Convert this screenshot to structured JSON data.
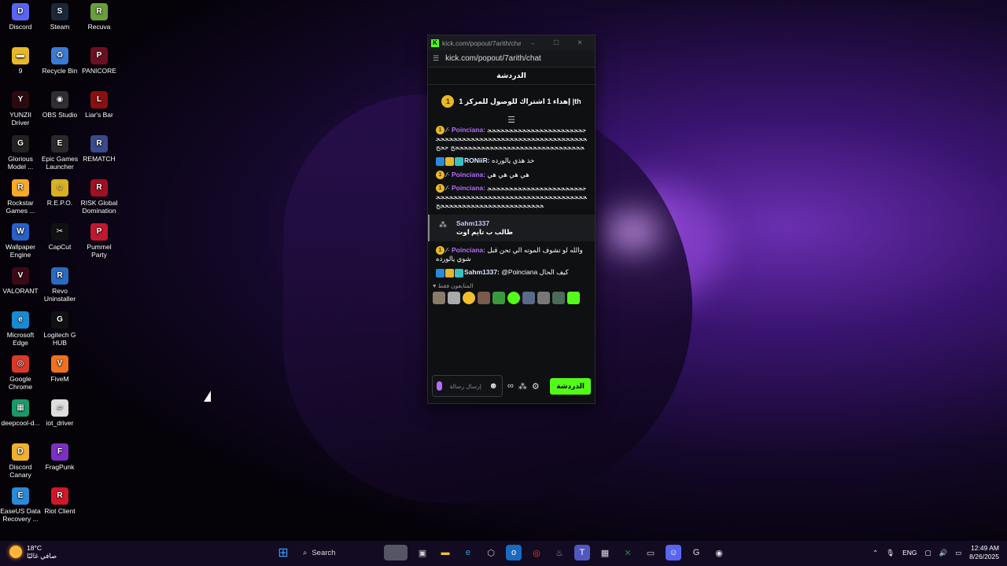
{
  "desktop": {
    "icons": [
      {
        "label": "Discord",
        "col": 0,
        "row": 0,
        "color": "#5865f2",
        "glyph": "D"
      },
      {
        "label": "Steam",
        "col": 1,
        "row": 0,
        "color": "#1b2838",
        "glyph": "S"
      },
      {
        "label": "Recuva",
        "col": 2,
        "row": 0,
        "color": "#6a9e3a",
        "glyph": "R"
      },
      {
        "label": "9",
        "col": 0,
        "row": 1,
        "color": "#e8b82b",
        "glyph": "▬"
      },
      {
        "label": "Recycle Bin",
        "col": 1,
        "row": 1,
        "color": "#3a7bd5",
        "glyph": "♻"
      },
      {
        "label": "PANICORE",
        "col": 2,
        "row": 1,
        "color": "#6b1020",
        "glyph": "P"
      },
      {
        "label": "YUNZII Driver",
        "col": 0,
        "row": 2,
        "color": "#2a0a10",
        "glyph": "Y"
      },
      {
        "label": "OBS Studio",
        "col": 1,
        "row": 2,
        "color": "#302e31",
        "glyph": "◉"
      },
      {
        "label": "Liar's Bar",
        "col": 2,
        "row": 2,
        "color": "#8a1010",
        "glyph": "L"
      },
      {
        "label": "Glorious Model ...",
        "col": 0,
        "row": 3,
        "color": "#222",
        "glyph": "G"
      },
      {
        "label": "Epic Games Launcher",
        "col": 1,
        "row": 3,
        "color": "#2a2a2a",
        "glyph": "E"
      },
      {
        "label": "REMATCH",
        "col": 2,
        "row": 3,
        "color": "#3a4a8a",
        "glyph": "R"
      },
      {
        "label": "Rockstar Games ...",
        "col": 0,
        "row": 4,
        "color": "#f7a928",
        "glyph": "R"
      },
      {
        "label": "R.E.P.O.",
        "col": 1,
        "row": 4,
        "color": "#d8b020",
        "glyph": "☺"
      },
      {
        "label": "RISK Global Domination",
        "col": 2,
        "row": 4,
        "color": "#a01020",
        "glyph": "R"
      },
      {
        "label": "Wallpaper Engine",
        "col": 0,
        "row": 5,
        "color": "#2860c8",
        "glyph": "W"
      },
      {
        "label": "CapCut",
        "col": 1,
        "row": 5,
        "color": "#111",
        "glyph": "✂"
      },
      {
        "label": "Pummel Party",
        "col": 2,
        "row": 5,
        "color": "#c01830",
        "glyph": "P"
      },
      {
        "label": "VALORANT",
        "col": 0,
        "row": 6,
        "color": "#3a0a18",
        "glyph": "V"
      },
      {
        "label": "Revo Uninstaller",
        "col": 1,
        "row": 6,
        "color": "#2a6ac0",
        "glyph": "R"
      },
      {
        "label": "Microsoft Edge",
        "col": 0,
        "row": 7,
        "color": "#1a8ad0",
        "glyph": "e"
      },
      {
        "label": "Logitech G HUB",
        "col": 1,
        "row": 7,
        "color": "#111",
        "glyph": "G"
      },
      {
        "label": "Google Chrome",
        "col": 0,
        "row": 8,
        "color": "#d83a2a",
        "glyph": "◎"
      },
      {
        "label": "FiveM",
        "col": 1,
        "row": 8,
        "color": "#f07020",
        "glyph": "V"
      },
      {
        "label": "deepcool-d...",
        "col": 0,
        "row": 9,
        "color": "#1a9a6a",
        "glyph": "▦"
      },
      {
        "label": "iot_driver",
        "col": 1,
        "row": 9,
        "color": "#ddd",
        "glyph": "▱"
      },
      {
        "label": "Discord Canary",
        "col": 0,
        "row": 10,
        "color": "#f0b030",
        "glyph": "D"
      },
      {
        "label": "FragPunk",
        "col": 1,
        "row": 10,
        "color": "#7a30c0",
        "glyph": "F"
      },
      {
        "label": "EaseUS Data Recovery ...",
        "col": 0,
        "row": 11,
        "color": "#2a8ad8",
        "glyph": "E"
      },
      {
        "label": "Riot Client",
        "col": 1,
        "row": 11,
        "color": "#d01828",
        "glyph": "R"
      }
    ]
  },
  "chat_window": {
    "window_title": "kick.com/popout/7arith/cha...",
    "url": "kick.com/popout/7arith/chat",
    "header": "الدردشة",
    "pinned": {
      "coin": "1",
      "text": "إهداء 1 اشتراك للوصول للمركز 1 |th"
    },
    "messages": [
      {
        "user": "Poinciana:",
        "style": "p",
        "coin": "1",
        "text": "ججججججججججججججججججججججججججججججججججججججججججججججججججججججججججججججججججججججججججججججججججججججججج ججج"
      },
      {
        "user": "RONiiR:",
        "style": "g",
        "badges": true,
        "text": "خذ هذي يالورده"
      },
      {
        "user": "Poinciana:",
        "style": "p",
        "coin": "1",
        "text": "هي هي هي هي"
      },
      {
        "user": "Poinciana:",
        "style": "p",
        "coin": "1",
        "text": "ججججججججججججججججججججججججججججججججججججججججججججججججججججججججججججججججججججججججججججججججججج"
      }
    ],
    "reply": {
      "user": "Sahm1337",
      "text": "طالب ب تايم اوت"
    },
    "messages2": [
      {
        "user": "Poinciana:",
        "style": "p",
        "coin": "1",
        "text": "والله لو تشوف الموته الي تحن قبل شوي يالورده"
      },
      {
        "user": "Sahm1337:",
        "style": "g",
        "badges": true,
        "text": "@Poinciana كيف الحال"
      }
    ],
    "viewers_label": "المتابعون فقط",
    "input_placeholder": "إرسال رسالة",
    "send_label": "الدردشة"
  },
  "taskbar": {
    "weather_temp": "18°C",
    "weather_desc": "صافي غالبًا",
    "search_label": "Search",
    "language": "ENG",
    "time": "12:49 AM",
    "date": "8/26/2025"
  }
}
